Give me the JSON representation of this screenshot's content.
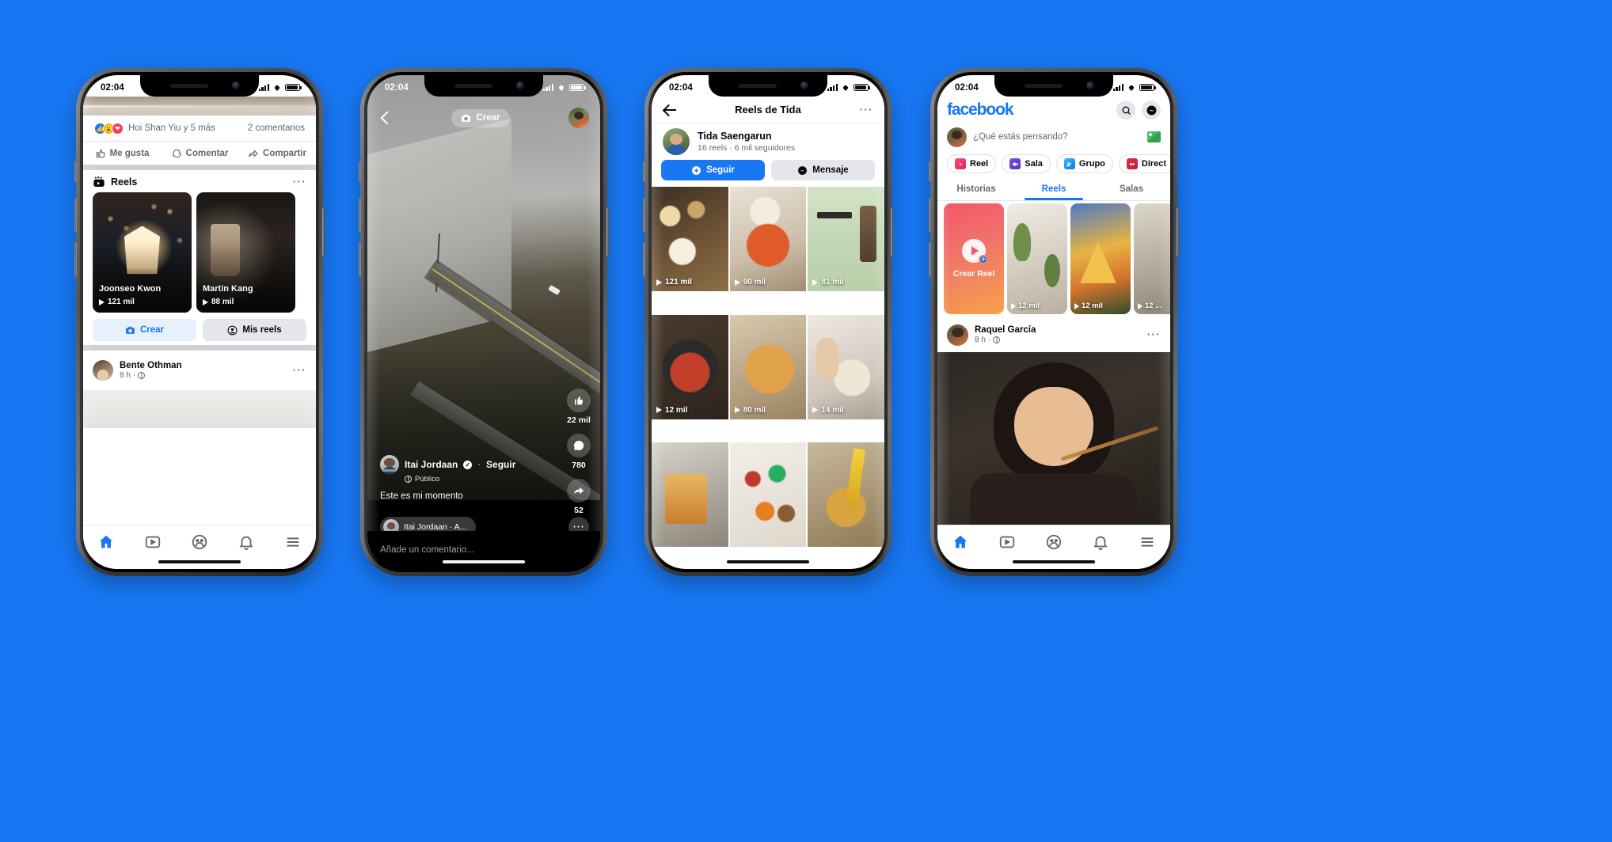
{
  "background_color": "#1877f2",
  "phone1": {
    "status": {
      "time": "02:04"
    },
    "post_top": {
      "reaction_text": "Hoi Shan Yiu y 5 más",
      "comments": "2 comentarios",
      "actions": [
        "Me gusta",
        "Comentar",
        "Compartir"
      ]
    },
    "reels_section": {
      "title": "Reels",
      "cards": [
        {
          "name": "Joonseo Kwon",
          "views": "121 mil"
        },
        {
          "name": "Martin Kang",
          "views": "88 mil"
        }
      ],
      "buttons": [
        "Crear",
        "Mis reels"
      ]
    },
    "post": {
      "name": "Bente Othman",
      "time": "8 h"
    },
    "nav": [
      "home",
      "video",
      "groups",
      "notifications",
      "menu"
    ]
  },
  "phone2": {
    "status": {
      "time": "02:04"
    },
    "top": {
      "create_label": "Crear"
    },
    "rail": {
      "like_count": "22 mil",
      "comment_count": "780",
      "share_count": "52"
    },
    "meta": {
      "username": "Itai Jordaan",
      "follow": "Seguir",
      "privacy": "Público",
      "caption": "Este es mi momento",
      "audio": "Itai Jordaan · A..."
    },
    "comment_placeholder": "Añade un comentario..."
  },
  "phone3": {
    "status": {
      "time": "02:04"
    },
    "header": {
      "title": "Reels de Tida"
    },
    "profile": {
      "name": "Tida Saengarun",
      "stats": "16 reels · 6 mil seguidores",
      "follow_label": "Seguir",
      "message_label": "Mensaje"
    },
    "grid": [
      {
        "views": "121 mil"
      },
      {
        "views": "90 mil"
      },
      {
        "views": "81 mil"
      },
      {
        "views": "12 mil"
      },
      {
        "views": "80 mil"
      },
      {
        "views": "14 mil"
      },
      {
        "views": ""
      },
      {
        "views": ""
      },
      {
        "views": ""
      }
    ]
  },
  "phone4": {
    "status": {
      "time": "02:04"
    },
    "brand": "facebook",
    "composer": {
      "placeholder": "¿Qué estás pensando?"
    },
    "chips": [
      "Reel",
      "Sala",
      "Grupo",
      "Direct"
    ],
    "tabs": [
      {
        "label": "Historias",
        "active": false
      },
      {
        "label": "Reels",
        "active": true
      },
      {
        "label": "Salas",
        "active": false
      }
    ],
    "reels_row": {
      "create_label": "Crear\nReel",
      "tiles": [
        {
          "views": "12 mil"
        },
        {
          "views": "12 mil"
        },
        {
          "views": "12 ..."
        }
      ]
    },
    "post": {
      "name": "Raquel García",
      "time": "8 h"
    }
  }
}
